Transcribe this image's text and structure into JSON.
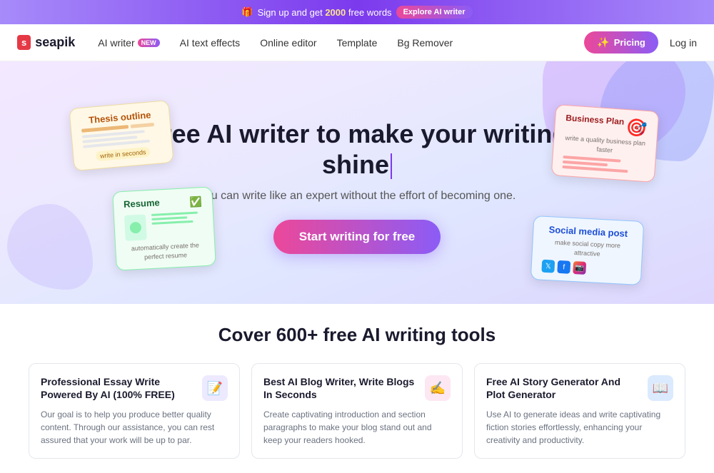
{
  "banner": {
    "gift_icon": "🎁",
    "text_before": "Sign up and get",
    "highlight": "2000",
    "text_after": "free words",
    "cta_label": "Explore AI writer"
  },
  "navbar": {
    "logo_box": "s",
    "logo_text": "seapik",
    "links": [
      {
        "label": "AI writer",
        "badge": "NEW",
        "id": "ai-writer"
      },
      {
        "label": "AI text effects",
        "badge": null,
        "id": "ai-text-effects"
      },
      {
        "label": "Online editor",
        "badge": null,
        "id": "online-editor"
      },
      {
        "label": "Template",
        "badge": null,
        "id": "template"
      },
      {
        "label": "Bg Remover",
        "badge": null,
        "id": "bg-remover"
      }
    ],
    "pricing_label": "Pricing",
    "login_label": "Log in"
  },
  "hero": {
    "title": "Free AI writer to make your writing shine",
    "subtitle": "You can write like an expert without the effort of becoming one.",
    "cta_label": "Start writing for free",
    "cards": {
      "thesis": {
        "title": "Thesis outline",
        "sub": "write in seconds"
      },
      "business": {
        "title": "Business Plan",
        "sub": "write a quality business plan faster"
      },
      "resume": {
        "title": "Resume",
        "sub": "automatically create the perfect resume"
      },
      "social": {
        "title": "Social media post",
        "sub": "make social copy more attractive"
      }
    }
  },
  "tools": {
    "title": "Cover 600+ free AI writing tools",
    "cards": [
      {
        "title": "Professional Essay Write Powered By AI (100% FREE)",
        "description": "Our goal is to help you produce better quality content. Through our assistance, you can rest assured that your work will be up to par.",
        "icon": "📝",
        "icon_style": "icon-purple"
      },
      {
        "title": "Best AI Blog Writer, Write Blogs In Seconds",
        "description": "Create captivating introduction and section paragraphs to make your blog stand out and keep your readers hooked.",
        "icon": "✍️",
        "icon_style": "icon-pink"
      },
      {
        "title": "Free AI Story Generator And Plot Generator",
        "description": "Use AI to generate ideas and write captivating fiction stories effortlessly, enhancing your creativity and productivity.",
        "icon": "📖",
        "icon_style": "icon-blue"
      }
    ]
  }
}
